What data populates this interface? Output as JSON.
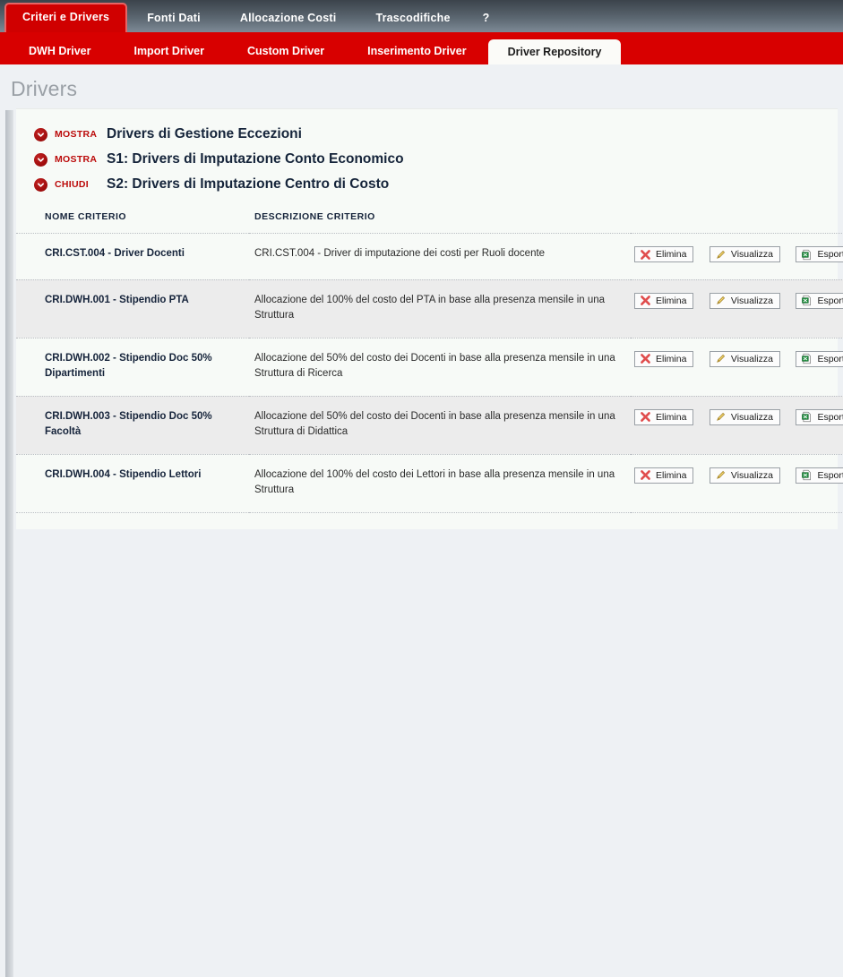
{
  "main_nav": {
    "tabs": [
      {
        "label": "Criteri e Drivers",
        "active": true
      },
      {
        "label": "Fonti Dati",
        "active": false
      },
      {
        "label": "Allocazione Costi",
        "active": false
      },
      {
        "label": "Trascodifiche",
        "active": false
      },
      {
        "label": "?",
        "active": false
      }
    ]
  },
  "sub_nav": {
    "tabs": [
      {
        "label": "DWH Driver",
        "active": false
      },
      {
        "label": "Import Driver",
        "active": false
      },
      {
        "label": "Custom Driver",
        "active": false
      },
      {
        "label": "Inserimento Driver",
        "active": false
      },
      {
        "label": "Driver Repository",
        "active": true
      }
    ]
  },
  "page": {
    "title": "Drivers"
  },
  "accordion": [
    {
      "action": "MOSTRA",
      "title": "Drivers di Gestione Eccezioni",
      "expanded": false,
      "icon": "chevron-down-circle-icon"
    },
    {
      "action": "MOSTRA",
      "title": "S1: Drivers di Imputazione Conto Economico",
      "expanded": false,
      "icon": "chevron-down-circle-icon"
    },
    {
      "action": "CHIUDI",
      "title": "S2: Drivers di Imputazione Centro di Costo",
      "expanded": true,
      "icon": "chevron-down-circle-icon"
    }
  ],
  "table": {
    "headers": {
      "name": "NOME CRITERIO",
      "description": "DESCRIZIONE CRITERIO",
      "actions": ""
    },
    "actions": {
      "delete": "Elimina",
      "view": "Visualizza",
      "export": "Esporta"
    },
    "rows": [
      {
        "name": "CRI.CST.004 - Driver Docenti",
        "description": "CRI.CST.004 - Driver di imputazione dei costi per Ruoli docente",
        "striped": false
      },
      {
        "name": "CRI.DWH.001 - Stipendio PTA",
        "description": "Allocazione del 100% del costo del PTA in base alla presenza mensile in una Struttura",
        "striped": true
      },
      {
        "name": "CRI.DWH.002 - Stipendio Doc 50% Dipartimenti",
        "description": "Allocazione del 50% del costo dei Docenti in base alla presenza mensile in una Struttura di Ricerca",
        "striped": false
      },
      {
        "name": "CRI.DWH.003 - Stipendio Doc 50% Facoltà",
        "description": "Allocazione del 50% del costo dei Docenti in base alla presenza mensile in una Struttura di Didattica",
        "striped": true
      },
      {
        "name": "CRI.DWH.004 - Stipendio Lettori",
        "description": "Allocazione del 100% del costo dei Lettori in base alla presenza mensile in una Struttura",
        "striped": false
      }
    ]
  },
  "colors": {
    "brand_red": "#d80000",
    "accent_dark_red": "#bb0a0a",
    "heading_navy": "#16243b",
    "panel_bg": "#f7faf7",
    "stripe_bg": "#ececec"
  }
}
